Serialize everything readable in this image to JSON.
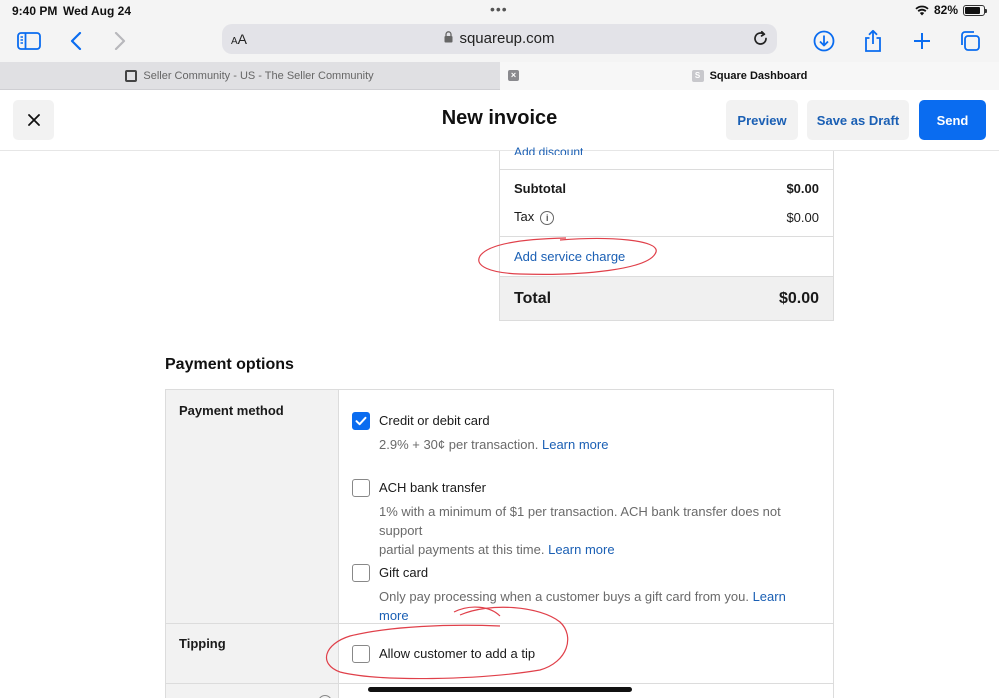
{
  "status_bar": {
    "time": "9:40 PM",
    "date": "Wed Aug 24",
    "battery": "82%",
    "battery_level": 0.82
  },
  "browser": {
    "text_size_label": "AA",
    "url": "squareup.com",
    "icons": [
      "sidebar-icon",
      "back-icon",
      "forward-icon",
      "lock-icon",
      "reload-icon",
      "download-icon",
      "share-icon",
      "new-tab-icon",
      "tabs-overview-icon"
    ],
    "tabs": [
      {
        "title": "Seller Community - US - The Seller Community",
        "active": false
      },
      {
        "title": "Square Dashboard",
        "favicon": "S",
        "active": true
      }
    ]
  },
  "header": {
    "title": "New invoice",
    "preview_label": "Preview",
    "draft_label": "Save as Draft",
    "send_label": "Send"
  },
  "totals": {
    "add_discount_label": "Add discount",
    "subtotal_label": "Subtotal",
    "subtotal_value": "$0.00",
    "tax_label": "Tax",
    "tax_value": "$0.00",
    "add_service_charge_label": "Add service charge",
    "total_label": "Total",
    "total_value": "$0.00"
  },
  "payment_options": {
    "title": "Payment options",
    "method_label": "Payment method",
    "methods": [
      {
        "title": "Credit or debit card",
        "desc": "2.9% + 30¢ per transaction.",
        "link": "Learn more",
        "checked": true
      },
      {
        "title": "ACH bank transfer",
        "desc_line1": "1% with a minimum of $1 per transaction. ACH bank transfer does not support",
        "desc_line2": "partial payments at this time.",
        "link": "Learn more",
        "checked": false
      },
      {
        "title": "Gift card",
        "desc": "Only pay processing when a customer buys a gift card from you.",
        "link": "Learn more",
        "checked": false
      }
    ],
    "tipping_label": "Tipping",
    "tipping_option": {
      "title": "Allow customer to add a tip",
      "checked": false
    }
  },
  "colors": {
    "accent": "#0a6cf0",
    "link": "#1a5fb4",
    "annotation": "#e0404a"
  }
}
